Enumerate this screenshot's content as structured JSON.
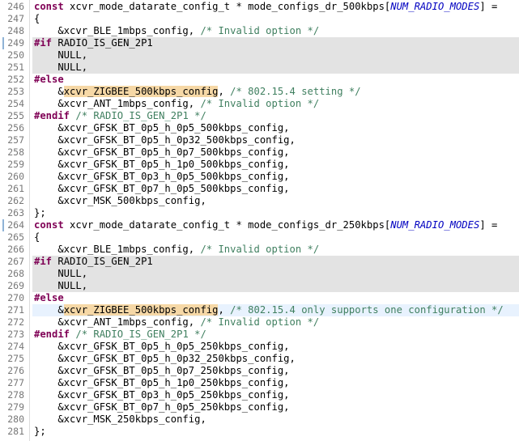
{
  "lines": [
    {
      "n": "246",
      "state": "normal",
      "t": [
        {
          "k": "kw",
          "s": "const"
        },
        {
          "s": " xcvr_mode_datarate_config_t * mode_configs_dr_500kbps["
        },
        {
          "k": "mac",
          "s": "NUM_RADIO_MODES"
        },
        {
          "s": "] ="
        }
      ]
    },
    {
      "n": "247",
      "state": "normal",
      "t": [
        {
          "s": "{"
        }
      ]
    },
    {
      "n": "248",
      "state": "normal",
      "t": [
        {
          "s": "    &xcvr_BLE_1mbps_config, "
        },
        {
          "k": "cm",
          "s": "/* Invalid option */"
        }
      ]
    },
    {
      "n": "249",
      "state": "inactive",
      "t": [
        {
          "k": "kw",
          "s": "#if"
        },
        {
          "s": " RADIO_IS_GEN_2P1"
        }
      ]
    },
    {
      "n": "250",
      "state": "inactive",
      "t": [
        {
          "s": "    NULL,"
        }
      ]
    },
    {
      "n": "251",
      "state": "inactive",
      "t": [
        {
          "s": "    NULL,"
        }
      ]
    },
    {
      "n": "252",
      "state": "normal",
      "t": [
        {
          "k": "kw",
          "s": "#else"
        }
      ]
    },
    {
      "n": "253",
      "state": "normal",
      "t": [
        {
          "s": "    &"
        },
        {
          "k": "hl",
          "s": "xcvr_ZIGBEE_500kbps_config"
        },
        {
          "s": ", "
        },
        {
          "k": "cm",
          "s": "/* 802.15.4 setting */"
        }
      ]
    },
    {
      "n": "254",
      "state": "normal",
      "t": [
        {
          "s": "    &xcvr_ANT_1mbps_config, "
        },
        {
          "k": "cm",
          "s": "/* Invalid option */"
        }
      ]
    },
    {
      "n": "255",
      "state": "normal",
      "t": [
        {
          "k": "kw",
          "s": "#endif"
        },
        {
          "s": " "
        },
        {
          "k": "cm",
          "s": "/* RADIO_IS_GEN_2P1 */"
        }
      ]
    },
    {
      "n": "256",
      "state": "normal",
      "t": [
        {
          "s": "    &xcvr_GFSK_BT_0p5_h_0p5_500kbps_config,"
        }
      ]
    },
    {
      "n": "257",
      "state": "normal",
      "t": [
        {
          "s": "    &xcvr_GFSK_BT_0p5_h_0p32_500kbps_config,"
        }
      ]
    },
    {
      "n": "258",
      "state": "normal",
      "t": [
        {
          "s": "    &xcvr_GFSK_BT_0p5_h_0p7_500kbps_config,"
        }
      ]
    },
    {
      "n": "259",
      "state": "normal",
      "t": [
        {
          "s": "    &xcvr_GFSK_BT_0p5_h_1p0_500kbps_config,"
        }
      ]
    },
    {
      "n": "260",
      "state": "normal",
      "t": [
        {
          "s": "    &xcvr_GFSK_BT_0p3_h_0p5_500kbps_config,"
        }
      ]
    },
    {
      "n": "261",
      "state": "normal",
      "t": [
        {
          "s": "    &xcvr_GFSK_BT_0p7_h_0p5_500kbps_config,"
        }
      ]
    },
    {
      "n": "262",
      "state": "normal",
      "t": [
        {
          "s": "    &xcvr_MSK_500kbps_config,"
        }
      ]
    },
    {
      "n": "263",
      "state": "normal",
      "t": [
        {
          "s": "};"
        }
      ]
    },
    {
      "n": "264",
      "state": "normal",
      "t": [
        {
          "k": "kw",
          "s": "const"
        },
        {
          "s": " xcvr_mode_datarate_config_t * mode_configs_dr_250kbps["
        },
        {
          "k": "mac",
          "s": "NUM_RADIO_MODES"
        },
        {
          "s": "] ="
        }
      ]
    },
    {
      "n": "265",
      "state": "normal",
      "t": [
        {
          "s": "{"
        }
      ]
    },
    {
      "n": "266",
      "state": "normal",
      "t": [
        {
          "s": "    &xcvr_BLE_1mbps_config, "
        },
        {
          "k": "cm",
          "s": "/* Invalid option */"
        }
      ]
    },
    {
      "n": "267",
      "state": "inactive",
      "t": [
        {
          "k": "kw",
          "s": "#if"
        },
        {
          "s": " RADIO_IS_GEN_2P1"
        }
      ]
    },
    {
      "n": "268",
      "state": "inactive",
      "t": [
        {
          "s": "    NULL,"
        }
      ]
    },
    {
      "n": "269",
      "state": "inactive",
      "t": [
        {
          "s": "    NULL,"
        }
      ]
    },
    {
      "n": "270",
      "state": "normal",
      "t": [
        {
          "k": "kw",
          "s": "#else"
        }
      ]
    },
    {
      "n": "271",
      "state": "current",
      "t": [
        {
          "s": "    &"
        },
        {
          "k": "hl",
          "s": "xcvr_ZIGBEE_500kbps_config"
        },
        {
          "s": ", "
        },
        {
          "k": "cm",
          "s": "/* 802.15.4 only supports one configuration */"
        }
      ]
    },
    {
      "n": "272",
      "state": "normal",
      "t": [
        {
          "s": "    &xcvr_ANT_1mbps_config, "
        },
        {
          "k": "cm",
          "s": "/* Invalid option */"
        }
      ]
    },
    {
      "n": "273",
      "state": "normal",
      "t": [
        {
          "k": "kw",
          "s": "#endif"
        },
        {
          "s": " "
        },
        {
          "k": "cm",
          "s": "/* RADIO_IS_GEN_2P1 */"
        }
      ]
    },
    {
      "n": "274",
      "state": "normal",
      "t": [
        {
          "s": "    &xcvr_GFSK_BT_0p5_h_0p5_250kbps_config,"
        }
      ]
    },
    {
      "n": "275",
      "state": "normal",
      "t": [
        {
          "s": "    &xcvr_GFSK_BT_0p5_h_0p32_250kbps_config,"
        }
      ]
    },
    {
      "n": "276",
      "state": "normal",
      "t": [
        {
          "s": "    &xcvr_GFSK_BT_0p5_h_0p7_250kbps_config,"
        }
      ]
    },
    {
      "n": "277",
      "state": "normal",
      "t": [
        {
          "s": "    &xcvr_GFSK_BT_0p5_h_1p0_250kbps_config,"
        }
      ]
    },
    {
      "n": "278",
      "state": "normal",
      "t": [
        {
          "s": "    &xcvr_GFSK_BT_0p3_h_0p5_250kbps_config,"
        }
      ]
    },
    {
      "n": "279",
      "state": "normal",
      "t": [
        {
          "s": "    &xcvr_GFSK_BT_0p7_h_0p5_250kbps_config,"
        }
      ]
    },
    {
      "n": "280",
      "state": "normal",
      "t": [
        {
          "s": "    &xcvr_MSK_250kbps_config,"
        }
      ]
    },
    {
      "n": "281",
      "state": "normal",
      "t": [
        {
          "s": "};"
        }
      ]
    }
  ],
  "colors": {
    "keyword": "#7f0055",
    "comment": "#3f7f5f",
    "macro": "#0000c0",
    "inactive_bg": "#e3e3e3",
    "current_line_bg": "#e8f2fe",
    "occurrence_bg": "#f6d8a6"
  }
}
